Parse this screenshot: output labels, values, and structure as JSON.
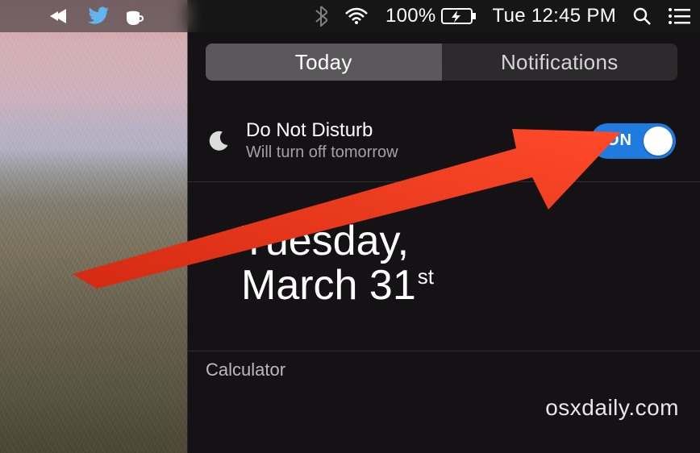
{
  "menubar": {
    "battery_percent": "100%",
    "clock": "Tue 12:45 PM",
    "icons": {
      "arrows": "arrows-icon",
      "twitter": "twitter-icon",
      "coffee": "coffee-icon",
      "bluetooth": "bluetooth-icon",
      "wifi": "wifi-icon",
      "battery": "battery-charging-icon",
      "spotlight": "search-icon",
      "notifications": "list-icon"
    }
  },
  "segmented": {
    "today": "Today",
    "notifications": "Notifications",
    "selected": "today"
  },
  "dnd": {
    "title": "Do Not Disturb",
    "subtitle": "Will turn off tomorrow",
    "toggle_label": "ON",
    "toggle_state": true
  },
  "date": {
    "line1": "Tuesday,",
    "line2_prefix": "March 31",
    "line2_suffix": "st"
  },
  "widget": {
    "calculator_label": "Calculator"
  },
  "watermark": "osxdaily.com",
  "colors": {
    "toggle_on": "#1f7be0",
    "arrow": "#ff3a1f"
  }
}
